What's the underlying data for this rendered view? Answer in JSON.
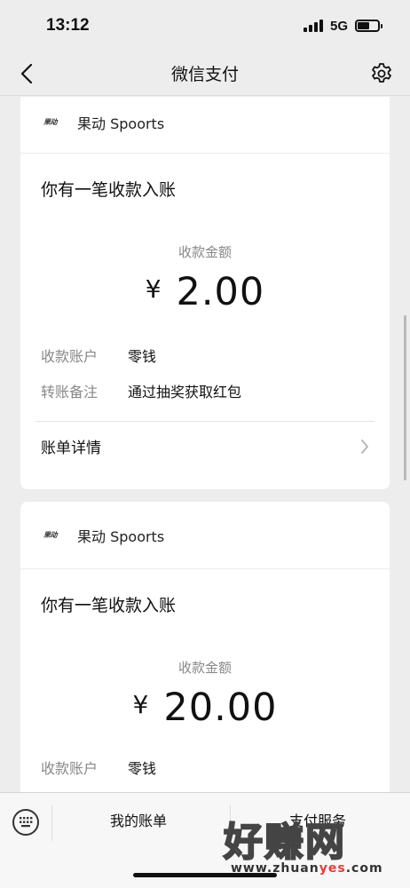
{
  "status_bar": {
    "time": "13:12",
    "network": "5G"
  },
  "nav": {
    "title": "微信支付"
  },
  "cards": [
    {
      "brand_logo": "果动",
      "brand_name": "果动 Spoorts",
      "notice": "你有一笔收款入账",
      "amount_label": "收款金额",
      "currency": "¥",
      "amount": "2.00",
      "rows": [
        {
          "key": "收款账户",
          "value": "零钱"
        },
        {
          "key": "转账备注",
          "value": "通过抽奖获取红包"
        }
      ],
      "detail_label": "账单详情"
    },
    {
      "brand_logo": "果动",
      "brand_name": "果动 Spoorts",
      "notice": "你有一笔收款入账",
      "amount_label": "收款金额",
      "currency": "¥",
      "amount": "20.00",
      "rows": [
        {
          "key": "收款账户",
          "value": "零钱"
        }
      ]
    }
  ],
  "tab_bar": {
    "tab1": "我的账单",
    "tab2": "支付服务"
  },
  "watermark": {
    "cn": "好赚网",
    "url_pre": "www.zhuan",
    "url_hl": "yes",
    "url_post": ".com"
  },
  "colors": {
    "background": "#ededed",
    "card": "#ffffff",
    "secondary_text": "#888888"
  },
  "icons": [
    "back-arrow-icon",
    "gear-icon",
    "keyboard-icon",
    "chevron-right-icon"
  ]
}
